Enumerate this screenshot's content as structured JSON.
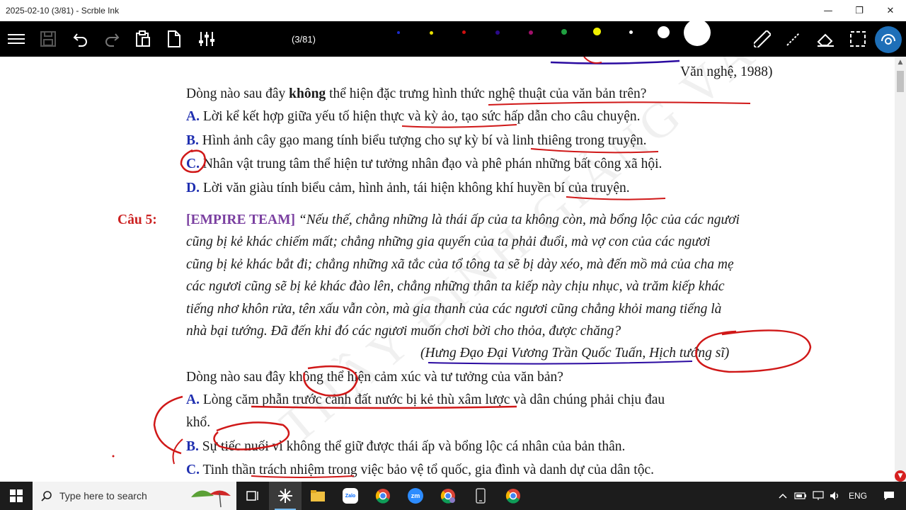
{
  "window": {
    "title": "2025-02-10 (3/81) - Scrble Ink",
    "minimize": "—",
    "restore": "❐",
    "close": "✕"
  },
  "toolbar": {
    "page_indicator": "(3/81)",
    "icons": [
      "menu-icon",
      "save-icon",
      "undo-icon",
      "redo-icon",
      "clipboard-icon",
      "page-icon",
      "sliders-icon",
      "ruler-icon",
      "pen-icon",
      "eraser-icon",
      "select-icon",
      "focus-icon"
    ],
    "colors": [
      "#1a2bcc",
      "#e8e000",
      "#d01010",
      "#2a0a8a",
      "#a0106a",
      "#20a040",
      "#f0f000",
      "#ffffff"
    ]
  },
  "document": {
    "prev_source": "Văn nghệ, 1988)",
    "q4_stem_a": "Dòng nào sau đây ",
    "q4_stem_bold": "không",
    "q4_stem_b": " thể hiện đặc trưng hình thức nghệ thuật của văn bản trên?",
    "q4_options": [
      {
        "letter": "A.",
        "text": " Lời kể kết hợp giữa yếu tố hiện thực và kỳ ảo, tạo sức hấp dẫn cho câu chuyện."
      },
      {
        "letter": "B.",
        "text": " Hình ảnh cây gạo mang tính biểu tượng cho sự kỳ bí và linh thiêng trong truyện."
      },
      {
        "letter": "C.",
        "text": " Nhân vật trung tâm thể hiện tư tưởng nhân đạo và phê phán những bất công xã hội."
      },
      {
        "letter": "D.",
        "text": " Lời văn giàu tính biểu cảm, hình ảnh, tái hiện không khí huyền bí của truyện."
      }
    ],
    "q5_label": "Câu 5:",
    "q5_team": "[EMPIRE TEAM]",
    "q5_passage": [
      " “Nếu thế, chẳng những là thái ấp của ta không còn, mà bổng lộc của các ngươi",
      "cũng bị kẻ khác chiếm mất; chẳng những gia quyến của ta phải đuổi, mà vợ con của các ngươi",
      "cũng bị kẻ khác bắt đi; chẳng những xã tắc của tổ tông ta sẽ bị dày xéo, mà đến mồ mả của cha mẹ",
      "các ngươi cũng sẽ bị kẻ khác đào lên, chẳng những thân ta kiếp này chịu nhục, và trăm kiếp khác",
      "tiếng nhơ khôn rửa, tên xấu vẫn còn, mà gia thanh của các ngươi cũng chẳng khỏi mang tiếng là",
      "nhà bại tướng. Đã đến khi đó các ngươi muốn chơi bời cho thỏa, được chăng?"
    ],
    "q5_source": "(Hưng Đạo Đại Vương Trần Quốc Tuấn, Hịch tướng sĩ)",
    "q5_stem": "Dòng nào sau đây không thể hiện cảm xúc và tư tưởng của văn bản?",
    "q5_options": [
      {
        "letter": "A.",
        "text": " Lòng căm phẫn trước cảnh đất nước bị kẻ thù xâm lược và dân chúng phải chịu đau"
      },
      {
        "letter": "",
        "text": "khổ."
      },
      {
        "letter": "B.",
        "text": " Sự tiếc nuối vì không thể giữ được thái ấp và bổng lộc cá nhân của bản thân."
      },
      {
        "letter": "C.",
        "text": " Tinh thần trách nhiệm trong việc bảo vệ tổ quốc, gia đình và danh dự của dân tộc."
      }
    ],
    "watermark": "THẦY ĐINH GIẢNG VĂN"
  },
  "taskbar": {
    "search_placeholder": "Type here to search",
    "apps": [
      "task-view-icon",
      "scrble-ink-icon",
      "file-explorer-icon",
      "zalo-icon",
      "chrome-icon",
      "zoom-icon",
      "chrome-profile-icon",
      "phone-link-icon",
      "chrome-alt-icon"
    ],
    "zalo_label": "Zalo",
    "zoom_label": "zm",
    "language": "ENG"
  }
}
